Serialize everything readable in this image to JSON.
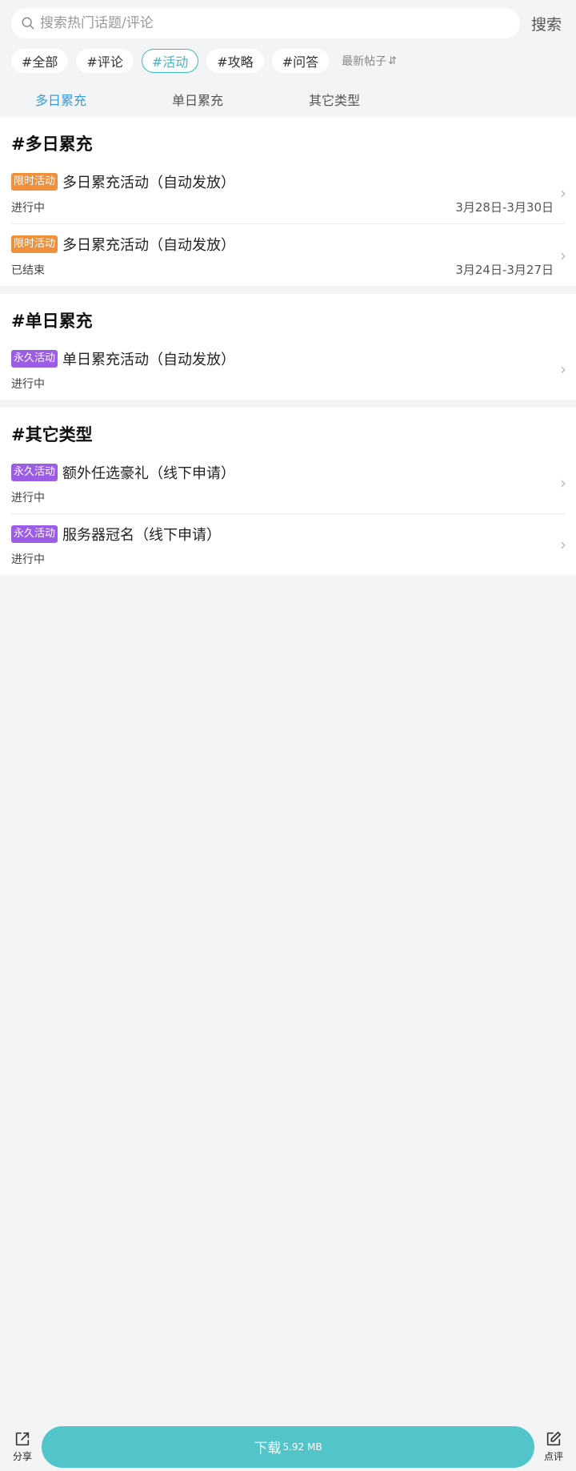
{
  "search": {
    "placeholder": "搜索热门话题/评论",
    "button": "搜索"
  },
  "chips": [
    {
      "label": "#全部",
      "active": false
    },
    {
      "label": "#评论",
      "active": false
    },
    {
      "label": "#活动",
      "active": true
    },
    {
      "label": "#攻略",
      "active": false
    },
    {
      "label": "#问答",
      "active": false
    }
  ],
  "sort": {
    "label": "最新帖子",
    "icon": "sort-arrows-icon"
  },
  "tabs": [
    {
      "label": "多日累充",
      "active": true
    },
    {
      "label": "单日累充",
      "active": false
    },
    {
      "label": "其它类型",
      "active": false
    }
  ],
  "sections": [
    {
      "title": "#多日累充",
      "items": [
        {
          "badge": "限时活动",
          "badge_type": "limited",
          "title": "多日累充活动（自动发放）",
          "status": "进行中",
          "date": "3月28日-3月30日"
        },
        {
          "badge": "限时活动",
          "badge_type": "limited",
          "title": "多日累充活动（自动发放）",
          "status": "已结束",
          "date": "3月24日-3月27日"
        }
      ]
    },
    {
      "title": "#单日累充",
      "items": [
        {
          "badge": "永久活动",
          "badge_type": "permanent",
          "title": "单日累充活动（自动发放）",
          "status": "进行中",
          "date": ""
        }
      ]
    },
    {
      "title": "#其它类型",
      "items": [
        {
          "badge": "永久活动",
          "badge_type": "permanent",
          "title": "额外任选豪礼（线下申请）",
          "status": "进行中",
          "date": ""
        },
        {
          "badge": "永久活动",
          "badge_type": "permanent",
          "title": "服务器冠名（线下申请）",
          "status": "进行中",
          "date": ""
        }
      ]
    }
  ],
  "bottom": {
    "share_label": "分享",
    "review_label": "点评",
    "download_label": "下载",
    "download_size": "5.92 MB"
  },
  "colors": {
    "accent": "#3bb9c4",
    "tab_active": "#3a9bd9",
    "badge_limited": "#f0903a",
    "badge_permanent": "#9b5de5",
    "download_bg": "#52c5cb"
  }
}
